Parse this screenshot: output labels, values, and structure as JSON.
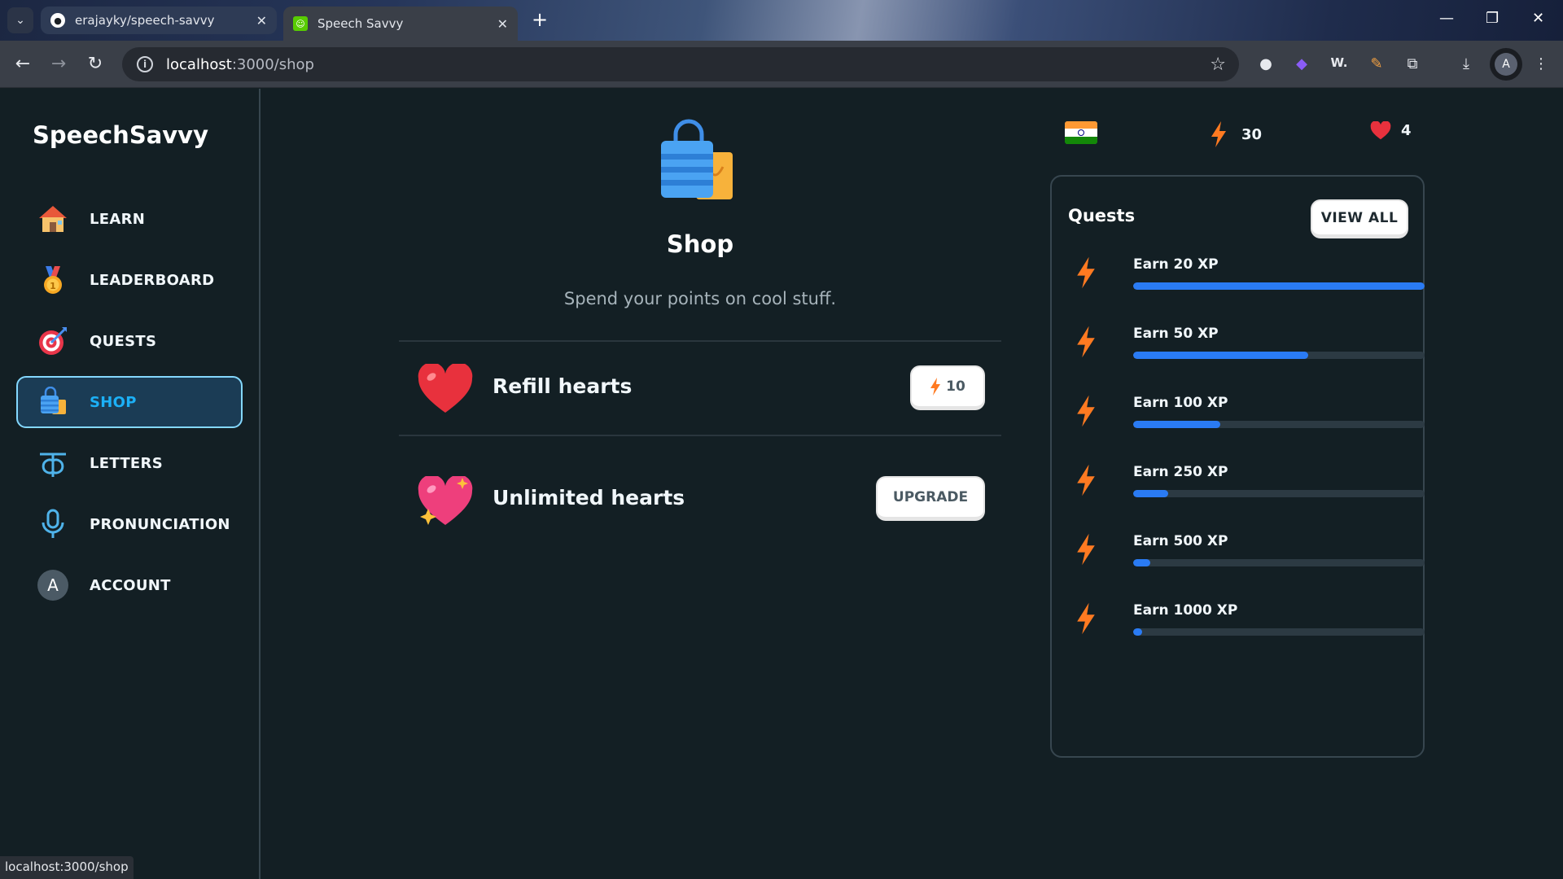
{
  "browser": {
    "tabs": [
      {
        "title": "erajayky/speech-savvy",
        "active": false
      },
      {
        "title": "Speech Savvy",
        "active": true
      }
    ],
    "url_host": "localhost",
    "url_path": ":3000/shop",
    "ext_w_label": "W.",
    "profile_initial": "A",
    "status_url": "localhost:3000/shop"
  },
  "sidebar": {
    "logo": "SpeechSavvy",
    "items": [
      {
        "label": "LEARN",
        "icon": "house-icon"
      },
      {
        "label": "LEADERBOARD",
        "icon": "medal-icon"
      },
      {
        "label": "QUESTS",
        "icon": "target-icon"
      },
      {
        "label": "SHOP",
        "icon": "shopping-bag-icon",
        "active": true
      },
      {
        "label": "LETTERS",
        "icon": "hindi-letter-icon"
      },
      {
        "label": "PRONUNCIATION",
        "icon": "microphone-icon"
      },
      {
        "label": "ACCOUNT",
        "icon": "account-avatar-icon",
        "avatar_letter": "A"
      }
    ]
  },
  "main": {
    "title": "Shop",
    "subtitle": "Spend your points on cool stuff.",
    "items": [
      {
        "label": "Refill hearts",
        "button": "10",
        "icon": "heart-icon"
      },
      {
        "label": "Unlimited hearts",
        "button": "UPGRADE",
        "icon": "sparkle-heart-icon"
      }
    ]
  },
  "stats": {
    "points": "30",
    "hearts": "4",
    "flag": "india-flag-icon"
  },
  "quests": {
    "title": "Quests",
    "view_all": "VIEW ALL",
    "items": [
      {
        "label": "Earn 20 XP",
        "progress": 1.0
      },
      {
        "label": "Earn 50 XP",
        "progress": 0.6
      },
      {
        "label": "Earn 100 XP",
        "progress": 0.3
      },
      {
        "label": "Earn 250 XP",
        "progress": 0.12
      },
      {
        "label": "Earn 500 XP",
        "progress": 0.06
      },
      {
        "label": "Earn 1000 XP",
        "progress": 0.03
      }
    ]
  },
  "colors": {
    "background": "#131f24",
    "accent_blue": "#1cb0f6",
    "progress_blue": "#2a7bf4",
    "bolt_orange": "#ff9600",
    "heart_red": "#ee3b45"
  }
}
